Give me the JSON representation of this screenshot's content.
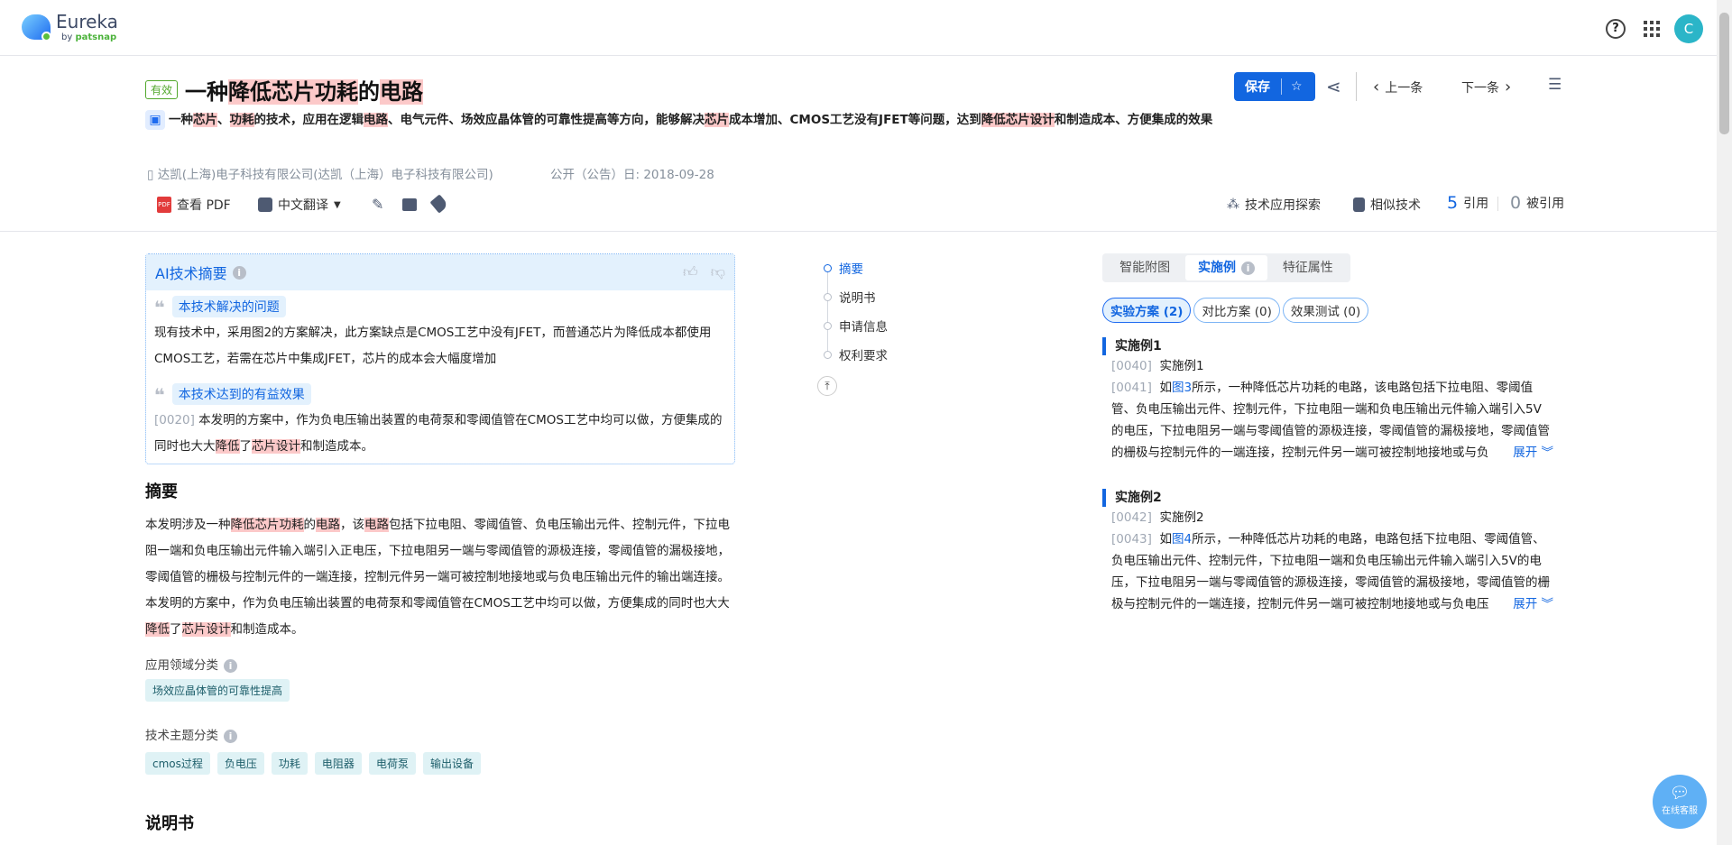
{
  "header": {
    "logo_name": "Eureka",
    "logo_by": "by ",
    "logo_brand": "patsnap",
    "help_icon": "?",
    "avatar": "C"
  },
  "doc": {
    "status": "有效",
    "title_parts": [
      "一种",
      "降低芯片功耗",
      "的",
      "电路"
    ],
    "summary_parts": [
      "一种",
      "芯片",
      "、",
      "功耗",
      "的技术，应用在逻辑",
      "电路",
      "、电气元件、场效应晶体管的可靠性提高等方向，能够解决",
      "芯片",
      "成本增加、CMOS工艺没有JFET等问题，达到",
      "降低芯片设计",
      "和制造成本、方便集成的效果"
    ],
    "applicant": "达凯(上海)电子科技有限公司(达凯（上海）电子科技有限公司)",
    "pub_date": "公开（公告）日: 2018-09-28"
  },
  "actions": {
    "save": "保存",
    "prev": "上一条",
    "next": "下一条"
  },
  "toolbar": {
    "pdf": "查看 PDF",
    "pdf_icon": "PDF",
    "translate": "中文翻译",
    "explore": "技术应用探索",
    "similar": "相似技术",
    "cite_count": "5",
    "cite_label": "引用",
    "cited_count": "0",
    "cited_label": "被引用"
  },
  "ai": {
    "title": "AI技术摘要",
    "problem_tag": "本技术解决的问题",
    "problem": "现有技术中，采用图2的方案解决，此方案缺点是CMOS工艺中没有JFET，而普通芯片为降低成本都使用CMOS工艺，若需在芯片中集成JFET，芯片的成本会大幅度增加",
    "effect_tag": "本技术达到的有益效果",
    "effect_num": "[0020]",
    "effect_parts": [
      " 本发明的方案中，作为负电压输出装置的电荷泵和零阈值管在CMOS工艺中均可以做，方便集成的同时也大大",
      "降低",
      "了",
      "芯片设计",
      "和制造成本。"
    ]
  },
  "abstract": {
    "heading": "摘要",
    "parts": [
      "本发明涉及一种",
      "降低芯片功耗",
      "的",
      "电路",
      "，该",
      "电路",
      "包括下拉电阻、零阈值管、负电压输出元件、控制元件，下拉电阻一端和负电压输出元件输入端引入正电压，下拉电阻另一端与零阈值管的源极连接，零阈值管的漏极接地，零阈值管的栅极与控制元件的一端连接，控制元件另一端可被控制地接地或与负电压输出元件的输出端连接。本发明的方案中，作为负电压输出装置的电荷泵和零阈值管在CMOS工艺中均可以做，方便集成的同时也大大",
      "降低",
      "了",
      "芯片设计",
      "和制造成本。"
    ]
  },
  "classification": {
    "field_label": "应用领域分类",
    "field_tags": [
      "场效应晶体管的可靠性提高"
    ],
    "topic_label": "技术主题分类",
    "topic_tags": [
      "cmos过程",
      "负电压",
      "功耗",
      "电阻器",
      "电荷泵",
      "输出设备"
    ]
  },
  "spec_heading": "说明书",
  "nav": {
    "items": [
      "摘要",
      "说明书",
      "申请信息",
      "权利要求"
    ]
  },
  "right": {
    "tabs": [
      "智能附图",
      "实施例",
      "特征属性"
    ],
    "pills": [
      "实验方案 (2)",
      "对比方案 (0)",
      "效果测试 (0)"
    ],
    "examples": [
      {
        "title": "实施例1",
        "n1": "[0040]",
        "t1": "实施例1",
        "n2": "[0041]",
        "pre": "如",
        "fig": "图3",
        "body": "所示，一种降低芯片功耗的电路，该电路包括下拉电阻、零阈值管、负电压输出元件、控制元件，下拉电阻一端和负电压输出元件输入端引入5V的电压，下拉电阻另一端与零阈值管的源极连接，零阈值管的漏极接地，零阈值管的栅极与控制元件的一端连接，控制元件另一端可被控制地接地或与负"
      },
      {
        "title": "实施例2",
        "n1": "[0042]",
        "t1": "实施例2",
        "n2": "[0043]",
        "pre": "如",
        "fig": "图4",
        "body": "所示，一种降低芯片功耗的电路，电路包括下拉电阻、零阈值管、负电压输出元件、控制元件，下拉电阻一端和负电压输出元件输入端引入5V的电压，下拉电阻另一端与零阈值管的源极连接，零阈值管的漏极接地，零阈值管的栅极与控制元件的一端连接，控制元件另一端可被控制地接地或与负电压"
      }
    ],
    "expand": "展开"
  },
  "chat": "在线客服"
}
